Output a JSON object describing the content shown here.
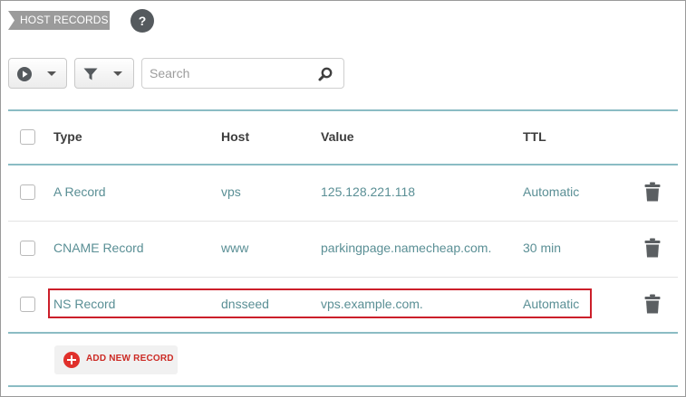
{
  "section": {
    "title": "HOST RECORDS",
    "help_icon": "question-mark"
  },
  "toolbar": {
    "actions_icon": "play-circle-icon",
    "filter_icon": "funnel-icon",
    "search_placeholder": "Search",
    "search_icon": "magnifier-icon"
  },
  "table": {
    "headers": {
      "type": "Type",
      "host": "Host",
      "value": "Value",
      "ttl": "TTL"
    },
    "rows": [
      {
        "type": "A Record",
        "host": "vps",
        "value": "125.128.221.118",
        "ttl": "Automatic"
      },
      {
        "type": "CNAME Record",
        "host": "www",
        "value": "parkingpage.namecheap.com.",
        "ttl": "30 min"
      },
      {
        "type": "NS Record",
        "host": "dnsseed",
        "value": "vps.example.com.",
        "ttl": "Automatic",
        "highlighted": true
      }
    ]
  },
  "add_record": {
    "label": "ADD NEW RECORD"
  },
  "colors": {
    "accent_teal": "#8bbcc4",
    "cell_text": "#5a8f95",
    "highlight_red": "#cc1f2a",
    "add_red": "#e0302b"
  }
}
